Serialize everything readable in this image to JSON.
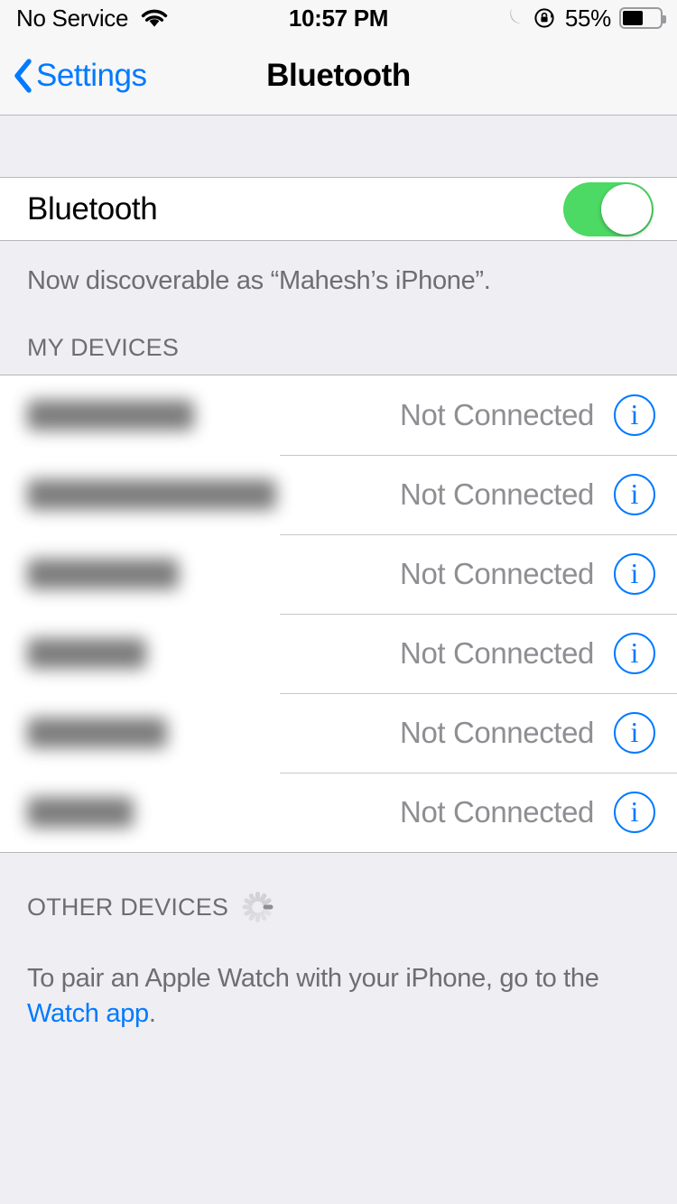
{
  "status_bar": {
    "carrier": "No Service",
    "wifi_icon": "wifi-icon",
    "time": "10:57 PM",
    "dnd_icon": "moon-icon",
    "rotation_lock_icon": "rotation-lock-icon",
    "battery_percent": "55%",
    "battery_level": 55,
    "battery_icon": "battery-icon"
  },
  "nav_bar": {
    "back_icon": "chevron-left-icon",
    "back_label": "Settings",
    "title": "Bluetooth"
  },
  "bluetooth": {
    "label": "Bluetooth",
    "toggle_state": "on",
    "toggle_on_color": "#4cd964",
    "discoverable_text": "Now discoverable as “Mahesh’s iPhone”."
  },
  "my_devices": {
    "header": "MY DEVICES",
    "rows": [
      {
        "name": "••••• •••",
        "name_width": 185,
        "status": "Not Connected",
        "info_icon": "info-circle-icon"
      },
      {
        "name": "•••••••• ••••••",
        "name_width": 276,
        "status": "Not Connected",
        "info_icon": "info-circle-icon"
      },
      {
        "name": "•••••• ••",
        "name_width": 168,
        "status": "Not Connected",
        "info_icon": "info-circle-icon"
      },
      {
        "name": "••• •••",
        "name_width": 132,
        "status": "Not Connected",
        "info_icon": "info-circle-icon"
      },
      {
        "name": "••••• ••",
        "name_width": 155,
        "status": "Not Connected",
        "info_icon": "info-circle-icon"
      },
      {
        "name": "•••••",
        "name_width": 118,
        "status": "Not Connected",
        "info_icon": "info-circle-icon"
      }
    ]
  },
  "other_devices": {
    "header": "OTHER DEVICES",
    "spinner_icon": "activity-spinner-icon",
    "footer_prefix": "To pair an Apple Watch with your iPhone, go to the ",
    "footer_link": "Watch app",
    "footer_suffix": "."
  },
  "colors": {
    "accent_blue": "#007aff",
    "toggle_green": "#4cd964",
    "secondary_text": "#6d6d72",
    "status_text": "#8e8e93",
    "group_background": "#efeef3"
  }
}
